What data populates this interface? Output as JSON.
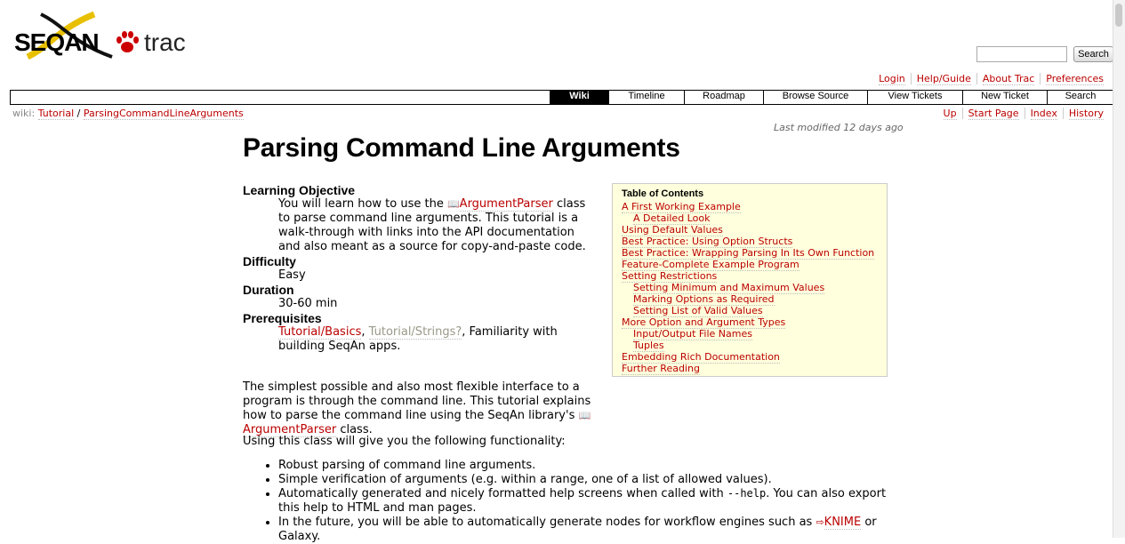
{
  "header": {
    "logo_text": "SEQAN trac",
    "search_button": "Search",
    "search_placeholder": ""
  },
  "metanav": [
    "Login",
    "Help/Guide",
    "About Trac",
    "Preferences"
  ],
  "mainnav": {
    "tabs": [
      {
        "label": "Wiki",
        "active": true
      },
      {
        "label": "Timeline",
        "active": false
      },
      {
        "label": "Roadmap",
        "active": false
      },
      {
        "label": "Browse Source",
        "active": false
      },
      {
        "label": "View Tickets",
        "active": false
      },
      {
        "label": "New Ticket",
        "active": false
      },
      {
        "label": "Search",
        "active": false
      }
    ]
  },
  "breadcrumb": {
    "prefix": "wiki:",
    "parts": [
      "Tutorial",
      "/",
      "ParsingCommandLineArguments"
    ]
  },
  "ctxtnav": [
    "Up",
    "Start Page",
    "Index",
    "History"
  ],
  "last_modified": "Last modified 12 days ago",
  "page": {
    "title": "Parsing Command Line Arguments",
    "definitions": [
      {
        "term": "Learning Objective",
        "pre": "You will learn how to use the ",
        "link": "ArgumentParser",
        "post": " class to parse command line arguments. This tutorial is a walk-through with links into the API documentation and also meant as a source for copy-and-paste code."
      },
      {
        "term": "Difficulty",
        "text": "Easy"
      },
      {
        "term": "Duration",
        "text": "30-60 min"
      },
      {
        "term": "Prerequisites",
        "link1": "Tutorial/Basics",
        "sep1": ", ",
        "link2": "Tutorial/Strings?",
        "post": ", Familiarity with building SeqAn apps."
      }
    ],
    "intro_pre": "The simplest possible and also most flexible interface to a program is through the command line. This tutorial explains how to parse the command line using the SeqAn library's ",
    "intro_link": "ArgumentParser",
    "intro_post": " class.",
    "functionality_intro": "Using this class will give you the following functionality:",
    "functionality": [
      {
        "text": "Robust parsing of command line arguments."
      },
      {
        "text": "Simple verification of arguments (e.g. within a range, one of a list of allowed values)."
      },
      {
        "pre": "Automatically generated and nicely formatted help screens when called with ",
        "code": "--help",
        "post": ". You can also export this help to HTML and man pages."
      },
      {
        "pre": "In the future, you will be able to automatically generate nodes for workflow engines such as ",
        "link": "KNIME",
        "post": " or Galaxy."
      }
    ]
  },
  "toc": {
    "title": "Table of Contents",
    "items": [
      {
        "label": "A First Working Example",
        "level": 1
      },
      {
        "label": "A Detailed Look",
        "level": 2
      },
      {
        "label": "Using Default Values",
        "level": 1
      },
      {
        "label": "Best Practice: Using Option Structs",
        "level": 1
      },
      {
        "label": "Best Practice: Wrapping Parsing In Its Own Function",
        "level": 1
      },
      {
        "label": "Feature-Complete Example Program",
        "level": 1
      },
      {
        "label": "Setting Restrictions",
        "level": 1
      },
      {
        "label": "Setting Minimum and Maximum Values",
        "level": 2
      },
      {
        "label": "Marking Options as Required",
        "level": 2
      },
      {
        "label": "Setting List of Valid Values",
        "level": 2
      },
      {
        "label": "More Option and Argument Types",
        "level": 1
      },
      {
        "label": "Input/Output File Names",
        "level": 2
      },
      {
        "label": "Tuples",
        "level": 2
      },
      {
        "label": "Embedding Rich Documentation",
        "level": 1
      },
      {
        "label": "Further Reading",
        "level": 1
      }
    ]
  }
}
